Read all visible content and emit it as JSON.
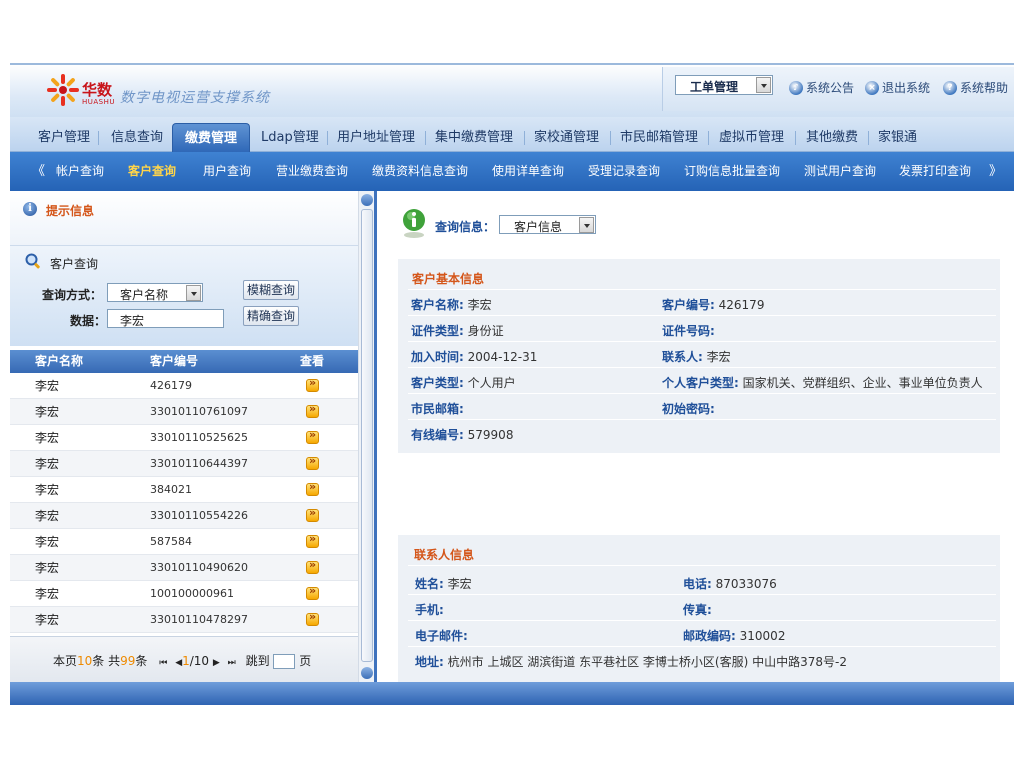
{
  "header": {
    "brand_cn": "华数",
    "brand_en": "HUASHU",
    "system_title": "数字电视运营支撑系统",
    "work_order_select": "工单管理",
    "links": [
      "系统公告",
      "退出系统",
      "系统帮助"
    ]
  },
  "main_nav": {
    "tabs": [
      "客户管理",
      "信息查询",
      "缴费管理",
      "Ldap管理",
      "用户地址管理",
      "集中缴费管理",
      "家校通管理",
      "市民邮箱管理",
      "虚拟币管理",
      "其他缴费",
      "家银通"
    ],
    "active": "缴费管理"
  },
  "sub_nav": {
    "prev": "《",
    "next": "》",
    "tabs": [
      "帐户查询",
      "客户查询",
      "用户查询",
      "营业缴费查询",
      "缴费资料信息查询",
      "使用详单查询",
      "受理记录查询",
      "订购信息批量查询",
      "测试用户查询",
      "发票打印查询"
    ],
    "active": "客户查询"
  },
  "left": {
    "tip_title": "提示信息",
    "search_title": "客户查询",
    "mode_label": "查询方式：",
    "mode_value": "客户名称",
    "data_label": "数据：",
    "data_value": "李宏",
    "fuzzy_btn": "模糊查询",
    "exact_btn": "精确查询",
    "columns": [
      "客户名称",
      "客户编号",
      "查看"
    ],
    "rows": [
      {
        "name": "李宏",
        "id": "426179"
      },
      {
        "name": "李宏",
        "id": "33010110761097"
      },
      {
        "name": "李宏",
        "id": "33010110525625"
      },
      {
        "name": "李宏",
        "id": "33010110644397"
      },
      {
        "name": "李宏",
        "id": "384021"
      },
      {
        "name": "李宏",
        "id": "33010110554226"
      },
      {
        "name": "李宏",
        "id": "587584"
      },
      {
        "name": "李宏",
        "id": "33010110490620"
      },
      {
        "name": "李宏",
        "id": "100100000961"
      },
      {
        "name": "李宏",
        "id": "33010110478297"
      }
    ],
    "pager": {
      "this_page_prefix": "本页",
      "this_page_count": "10",
      "this_page_suffix": "条 共",
      "total_count": "99",
      "total_suffix": "条",
      "first": "⏮",
      "prev": "◀",
      "current": "1",
      "total_pages": "/10",
      "next": "▶",
      "last": "⏭",
      "jump_label": "跳到",
      "page_label": "页"
    }
  },
  "right": {
    "query_label": "查询信息：",
    "query_value": "客户信息",
    "basic_title": "客户基本信息",
    "basic": {
      "name_label": "客户名称:",
      "name": "李宏",
      "no_label": "客户编号:",
      "no": "426179",
      "idtype_label": "证件类型:",
      "idtype": "身份证",
      "idno_label": "证件号码:",
      "idno": "",
      "join_label": "加入时间:",
      "join": "2004-12-31",
      "contact_label": "联系人:",
      "contact": "李宏",
      "ctype_label": "客户类型:",
      "ctype": "个人用户",
      "pctype_label": "个人客户类型:",
      "pctype": "国家机关、党群组织、企业、事业单位负责人",
      "mail_label": "市民邮箱:",
      "mail": "",
      "pwd_label": "初始密码:",
      "pwd": "",
      "cable_label": "有线编号:",
      "cable": "579908"
    },
    "contact_title": "联系人信息",
    "contact": {
      "name_label": "姓名:",
      "name": "李宏",
      "tel_label": "电话:",
      "tel": "87033076",
      "mobile_label": "手机:",
      "mobile": "",
      "fax_label": "传真:",
      "fax": "",
      "email_label": "电子邮件:",
      "email": "",
      "zip_label": "邮政编码:",
      "zip": "310002",
      "addr_label": "地址:",
      "addr": "杭州市 上城区 湖滨街道 东平巷社区 李博士桥小区(客服) 中山中路378号-2"
    }
  }
}
